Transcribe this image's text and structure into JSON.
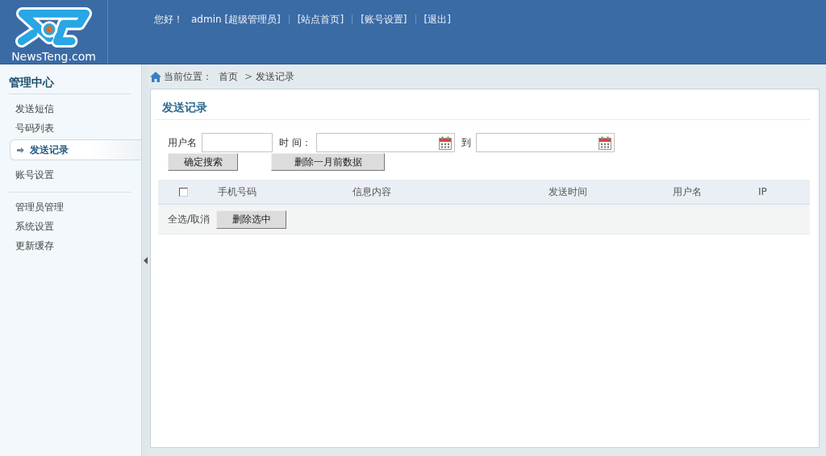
{
  "header": {
    "logo_text": "NewsTeng.com",
    "greeting": "您好！",
    "user": "admin [超级管理员]",
    "links": [
      {
        "label": "[站点首页]"
      },
      {
        "label": "[账号设置]"
      },
      {
        "label": "[退出]"
      }
    ]
  },
  "sidebar": {
    "title": "管理中心",
    "groups": [
      {
        "items": [
          {
            "label": "发送短信",
            "selected": false
          },
          {
            "label": "号码列表",
            "selected": false
          },
          {
            "label": "发送记录",
            "selected": true
          },
          {
            "label": "账号设置",
            "selected": false
          }
        ]
      },
      {
        "items": [
          {
            "label": "管理员管理",
            "selected": false
          },
          {
            "label": "系统设置",
            "selected": false
          },
          {
            "label": "更新缓存",
            "selected": false
          }
        ]
      }
    ]
  },
  "breadcrumb": {
    "label": "当前位置：",
    "separator": ">",
    "items": [
      {
        "label": "首页"
      },
      {
        "label": "发送记录"
      }
    ]
  },
  "panel": {
    "title": "发送记录",
    "filters": [
      {
        "label": "用户名",
        "kind": "text"
      },
      {
        "label": "时 间：",
        "kind": "date"
      },
      {
        "label": "到",
        "kind": "date"
      }
    ],
    "buttons": [
      {
        "label": "确定搜索"
      },
      {
        "label": "删除一月前数据"
      }
    ],
    "table": {
      "select_all": {
        "checked": false
      },
      "columns": [
        "手机号码",
        "信息内容",
        "发送时间",
        "用户名",
        "IP"
      ],
      "footer": {
        "toggle_label": "全选/取消",
        "button": "删除选中"
      }
    }
  }
}
